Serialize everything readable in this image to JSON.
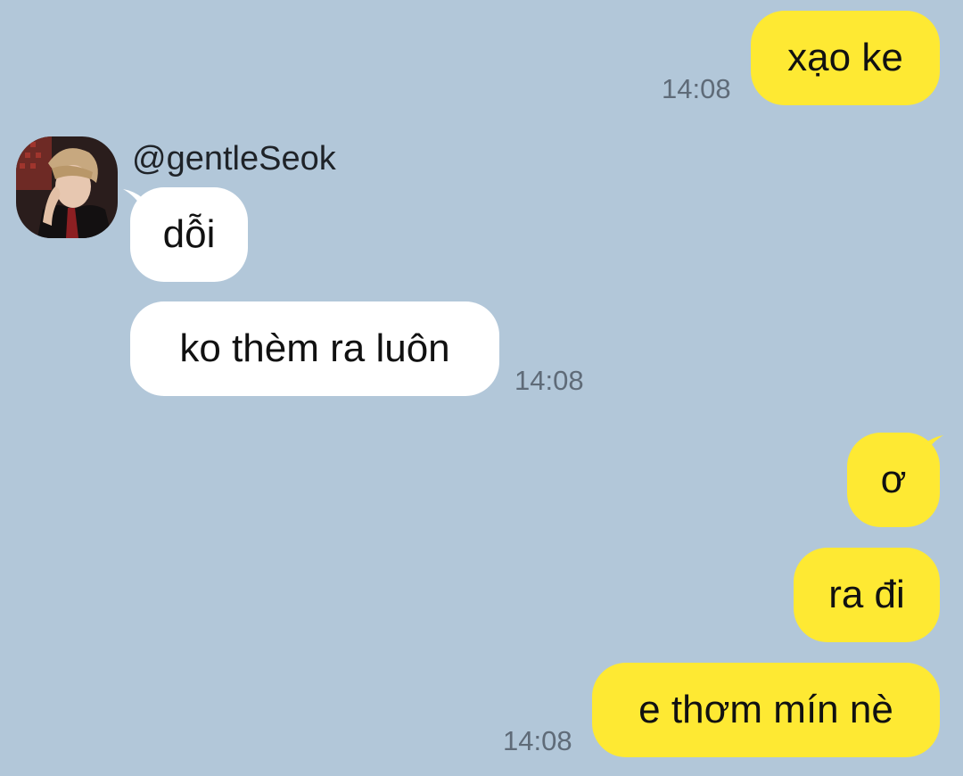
{
  "chat": {
    "colors": {
      "background": "#b2c7d9",
      "my_bubble": "#fee933",
      "their_bubble": "#ffffff"
    },
    "contact": {
      "name": "@gentleSeok",
      "avatar": "profile-photo"
    },
    "messages": [
      {
        "sender": "me",
        "text": "xạo ke",
        "time": "14:08"
      },
      {
        "sender": "them",
        "text": "dỗi"
      },
      {
        "sender": "them",
        "text": "ko thèm ra luôn",
        "time": "14:08"
      },
      {
        "sender": "me",
        "text": "ơ"
      },
      {
        "sender": "me",
        "text": "ra đi"
      },
      {
        "sender": "me",
        "text": "e thơm mín nè",
        "time": "14:08"
      }
    ]
  }
}
